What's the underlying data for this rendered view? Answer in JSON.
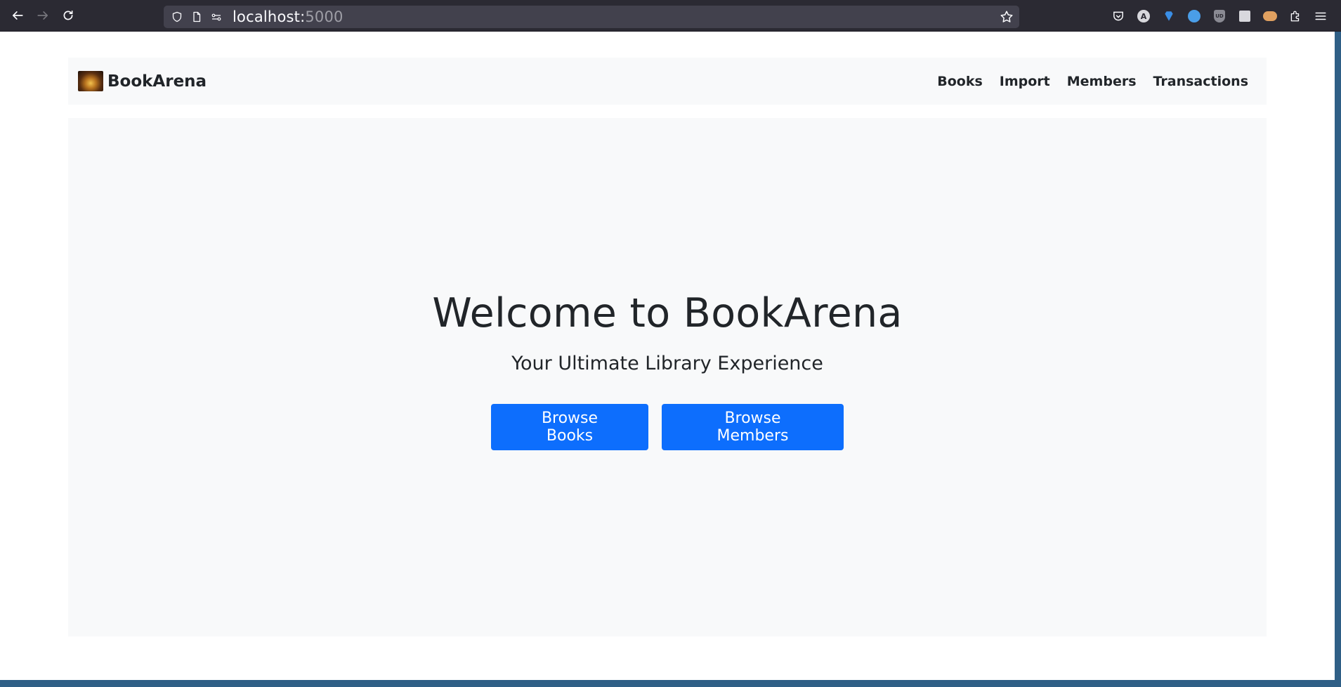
{
  "browser": {
    "url_host": "localhost:",
    "url_port": "5000"
  },
  "navbar": {
    "brand": "BookArena",
    "links": [
      "Books",
      "Import",
      "Members",
      "Transactions"
    ]
  },
  "hero": {
    "title": "Welcome to BookArena",
    "subtitle": "Your Ultimate Library Experience",
    "primary_button": "Browse Books",
    "secondary_button": "Browse Members"
  },
  "colors": {
    "primary": "#0d6efd",
    "surface": "#f8f9fa",
    "text": "#212529",
    "chrome": "#2b2a33"
  }
}
